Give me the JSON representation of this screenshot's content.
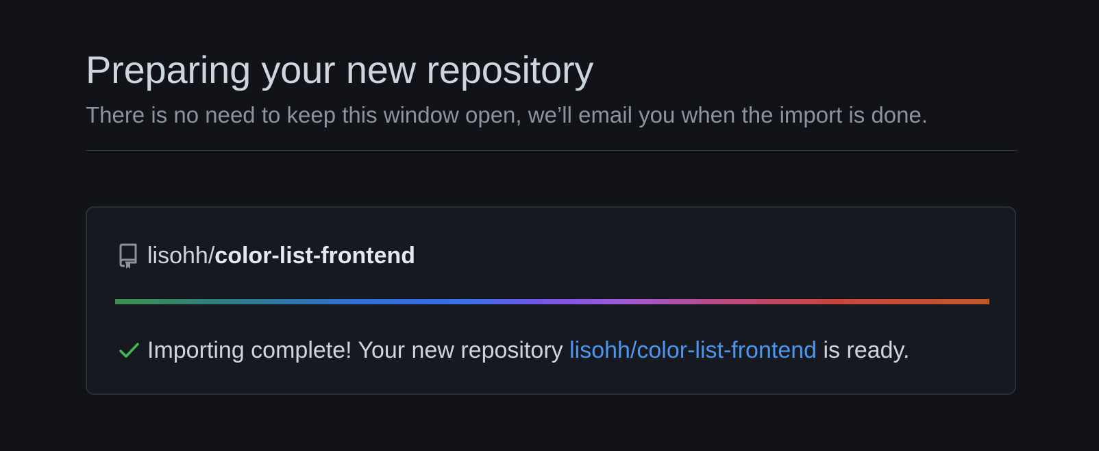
{
  "header": {
    "title": "Preparing your new repository",
    "subtitle": "There is no need to keep this window open, we’ll email you when the import is done."
  },
  "repo": {
    "icon": "repo-icon",
    "owner": "lisohh",
    "separator": "/",
    "name": "color-list-frontend"
  },
  "progress": {
    "value": 1.0
  },
  "status": {
    "icon": "check-icon",
    "prefix": "Importing complete! Your new repository ",
    "link_text": "lisohh/color-list-frontend",
    "suffix": " is ready."
  },
  "colors": {
    "background": "#111318",
    "card_background": "#161a20",
    "link": "#4d96f0",
    "success": "#3fb950"
  }
}
